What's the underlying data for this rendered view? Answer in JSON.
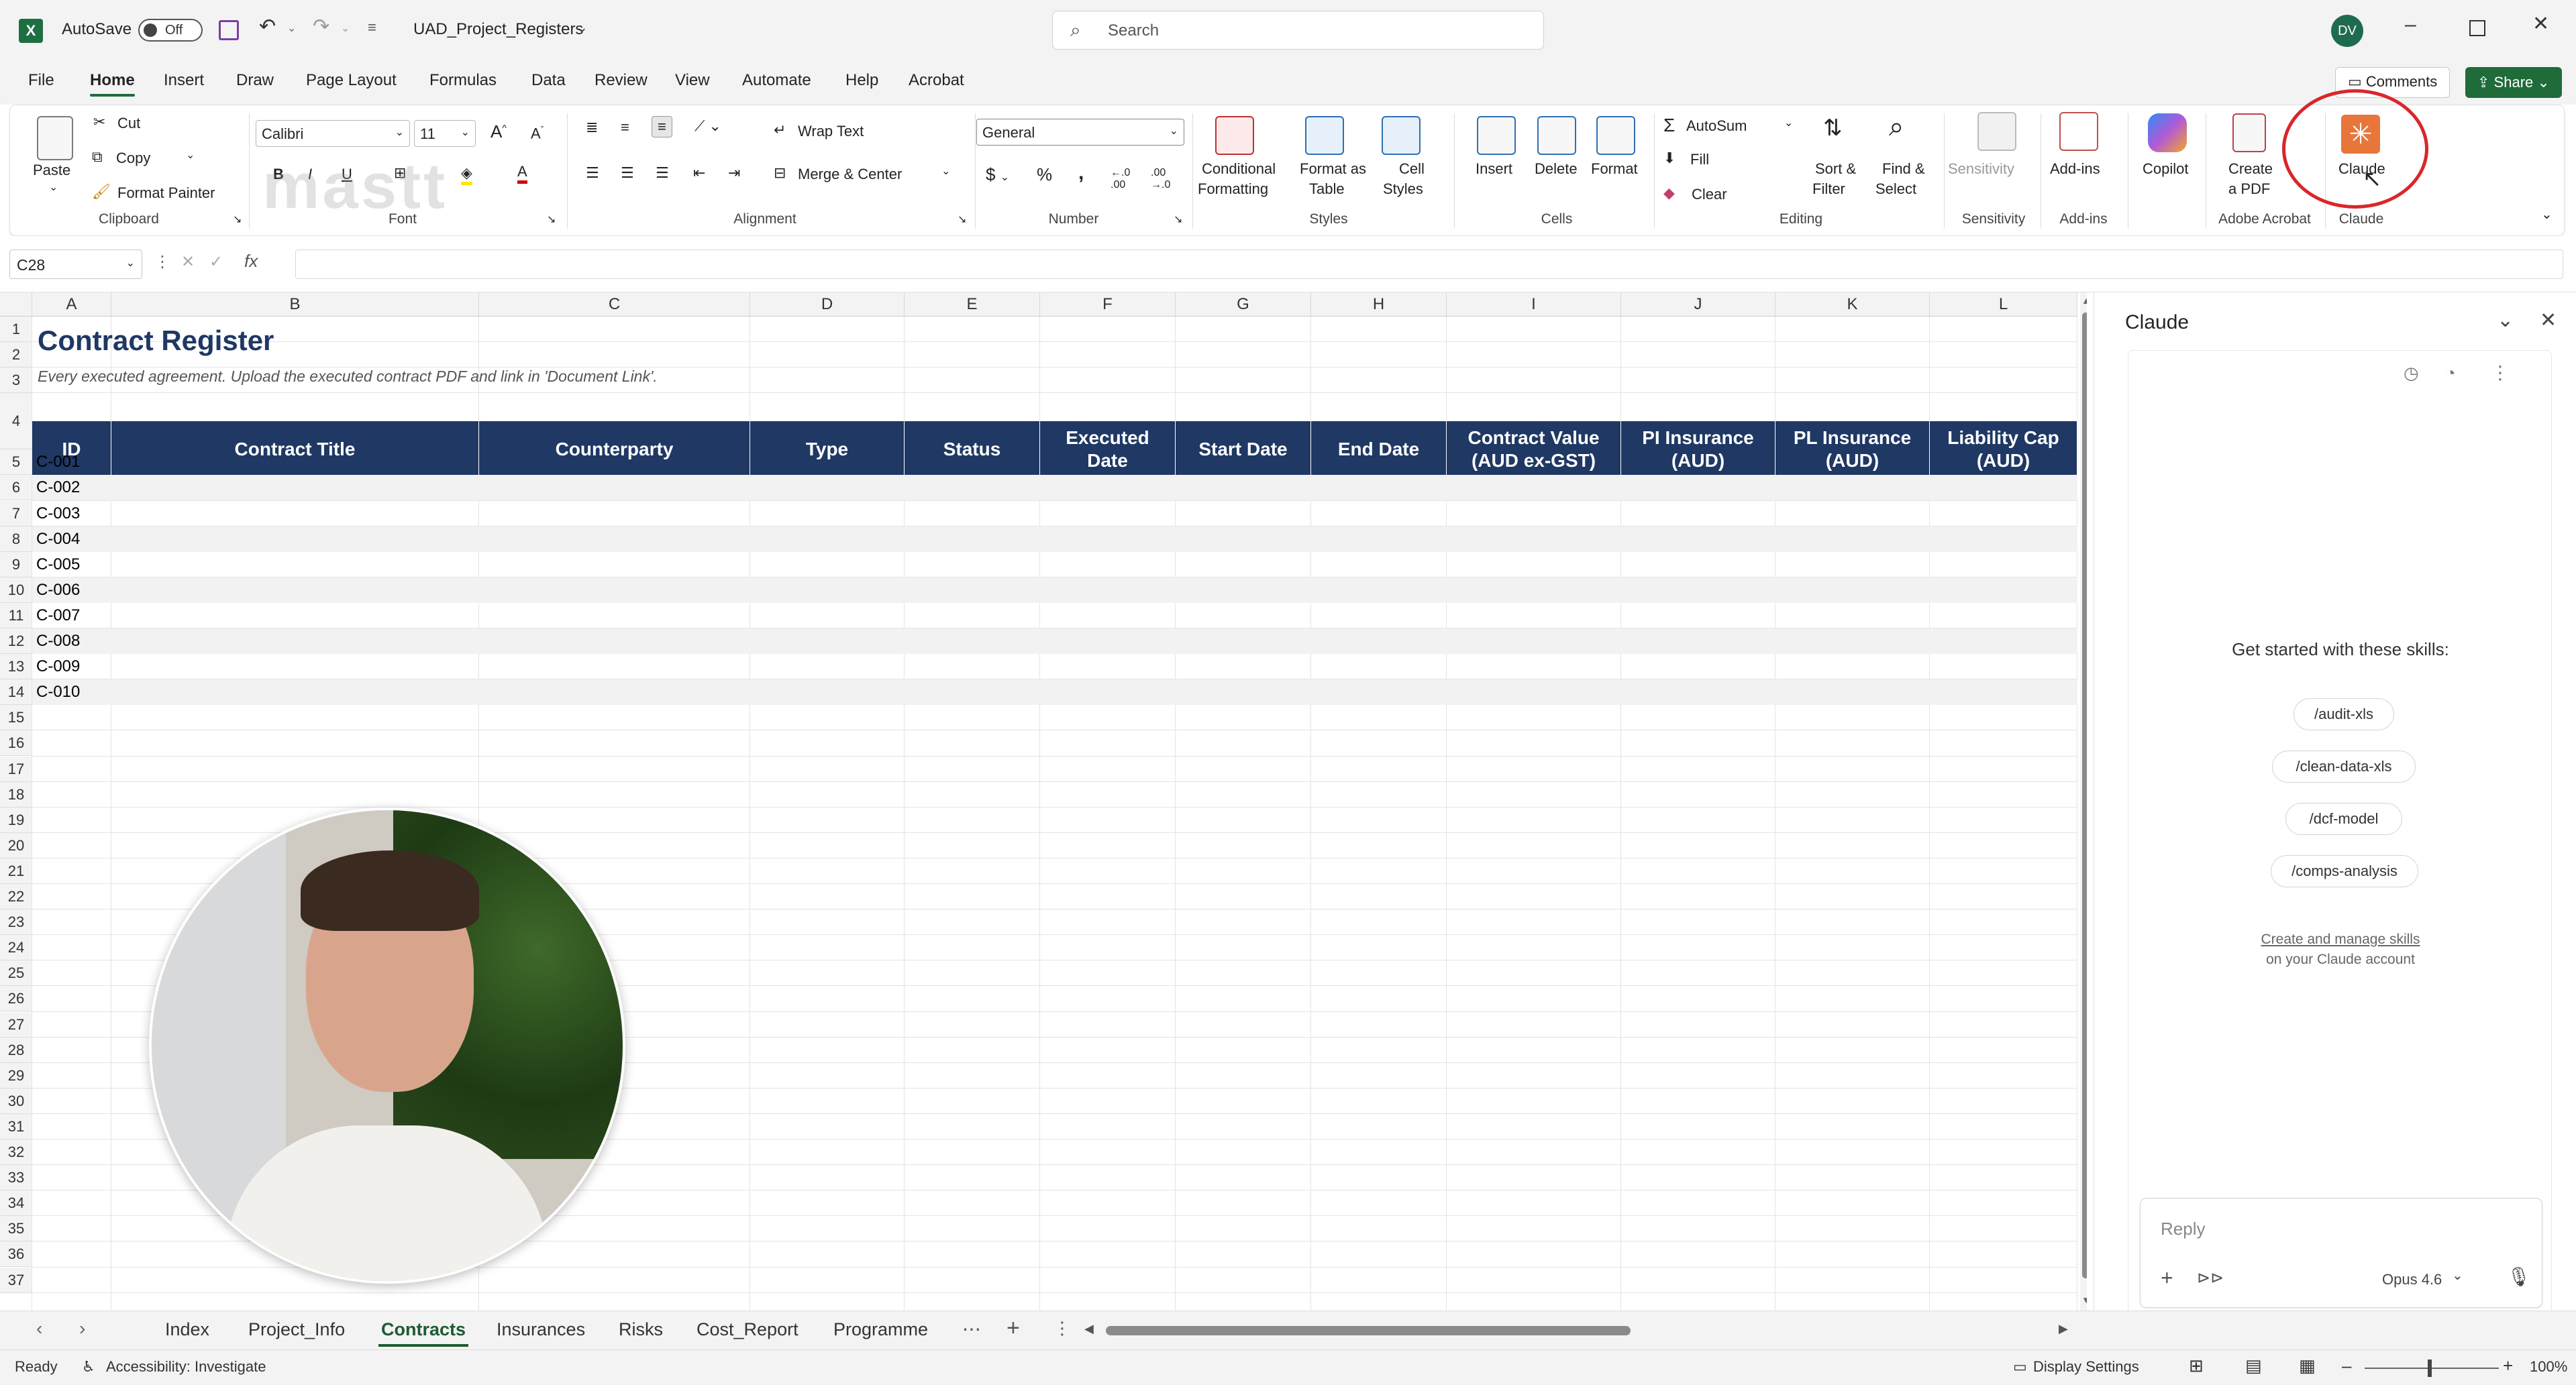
{
  "titlebar": {
    "autosave_label": "AutoSave",
    "autosave_state": "Off",
    "filename": "UAD_Project_Registers",
    "search_placeholder": "Search",
    "user_initials": "DV"
  },
  "menu": {
    "items": [
      "File",
      "Home",
      "Insert",
      "Draw",
      "Page Layout",
      "Formulas",
      "Data",
      "Review",
      "View",
      "Automate",
      "Help",
      "Acrobat"
    ],
    "comments": "Comments",
    "share": "Share"
  },
  "ribbon": {
    "clipboard": {
      "paste": "Paste",
      "cut": "Cut",
      "copy": "Copy",
      "format_painter": "Format Painter",
      "group": "Clipboard"
    },
    "font": {
      "name": "Calibri",
      "size": "11",
      "group": "Font"
    },
    "alignment": {
      "wrap": "Wrap Text",
      "merge": "Merge & Center",
      "group": "Alignment"
    },
    "number": {
      "format": "General",
      "group": "Number"
    },
    "styles": {
      "conditional": [
        "Conditional",
        "Formatting"
      ],
      "format_table": [
        "Format as",
        "Table"
      ],
      "cell_styles": [
        "Cell",
        "Styles"
      ],
      "group": "Styles"
    },
    "cells": {
      "insert": "Insert",
      "delete": "Delete",
      "format": "Format",
      "group": "Cells"
    },
    "editing": {
      "autosum": "AutoSum",
      "fill": "Fill",
      "clear": "Clear",
      "sort": [
        "Sort &",
        "Filter"
      ],
      "find": [
        "Find &",
        "Select"
      ],
      "group": "Editing"
    },
    "sensitivity": {
      "label": "Sensitivity",
      "group": "Sensitivity"
    },
    "addins": {
      "label": "Add-ins",
      "group": "Add-ins"
    },
    "copilot": {
      "label": "Copilot"
    },
    "acrobat": {
      "label": [
        "Create",
        "a PDF"
      ],
      "group": "Adobe Acrobat"
    },
    "claude": {
      "label": "Claude",
      "group": "Claude"
    }
  },
  "formula_bar": {
    "name_box": "C28",
    "fx": "fx"
  },
  "sheet": {
    "columns": [
      "A",
      "B",
      "C",
      "D",
      "E",
      "F",
      "G",
      "H",
      "I",
      "J",
      "K",
      "L"
    ],
    "title": "Contract Register",
    "subtitle": "Every executed agreement. Upload the executed contract PDF and link in 'Document Link'.",
    "headers": [
      "ID",
      "Contract Title",
      "Counterparty",
      "Type",
      "Status",
      "Executed Date",
      "Start Date",
      "End Date",
      "Contract Value (AUD ex-GST)",
      "PI Insurance (AUD)",
      "PL Insurance (AUD)",
      "Liability Cap (AUD)"
    ],
    "ids": [
      "C-001",
      "C-002",
      "C-003",
      "C-004",
      "C-005",
      "C-006",
      "C-007",
      "C-008",
      "C-009",
      "C-010"
    ],
    "row_numbers": [
      "1",
      "2",
      "3",
      "4",
      "5",
      "6",
      "7",
      "8",
      "9",
      "10",
      "11",
      "12",
      "13",
      "14",
      "15",
      "16",
      "17",
      "18",
      "19",
      "20",
      "21",
      "22",
      "23",
      "24",
      "25",
      "26",
      "27",
      "28",
      "29",
      "30",
      "31",
      "32",
      "33",
      "34",
      "35",
      "36",
      "37"
    ]
  },
  "claude_panel": {
    "title": "Claude",
    "prompt": "Get started with these skills:",
    "skills": [
      "/audit-xls",
      "/clean-data-xls",
      "/dcf-model",
      "/comps-analysis"
    ],
    "manage_link": "Create and manage skills",
    "manage_sub": "on your Claude account",
    "reply_placeholder": "Reply",
    "model": "Opus 4.6"
  },
  "tabs": {
    "items": [
      "Index",
      "Project_Info",
      "Contracts",
      "Insurances",
      "Risks",
      "Cost_Report",
      "Programme"
    ],
    "active": "Contracts"
  },
  "status": {
    "ready": "Ready",
    "accessibility": "Accessibility: Investigate",
    "display": "Display Settings",
    "zoom": "100%"
  },
  "colors": {
    "header_fill": "#1f3864",
    "title_text": "#1f3864",
    "accent_green": "#1f6b3a",
    "claude_orange": "#e8763a",
    "annotation_red": "#d9262b"
  }
}
